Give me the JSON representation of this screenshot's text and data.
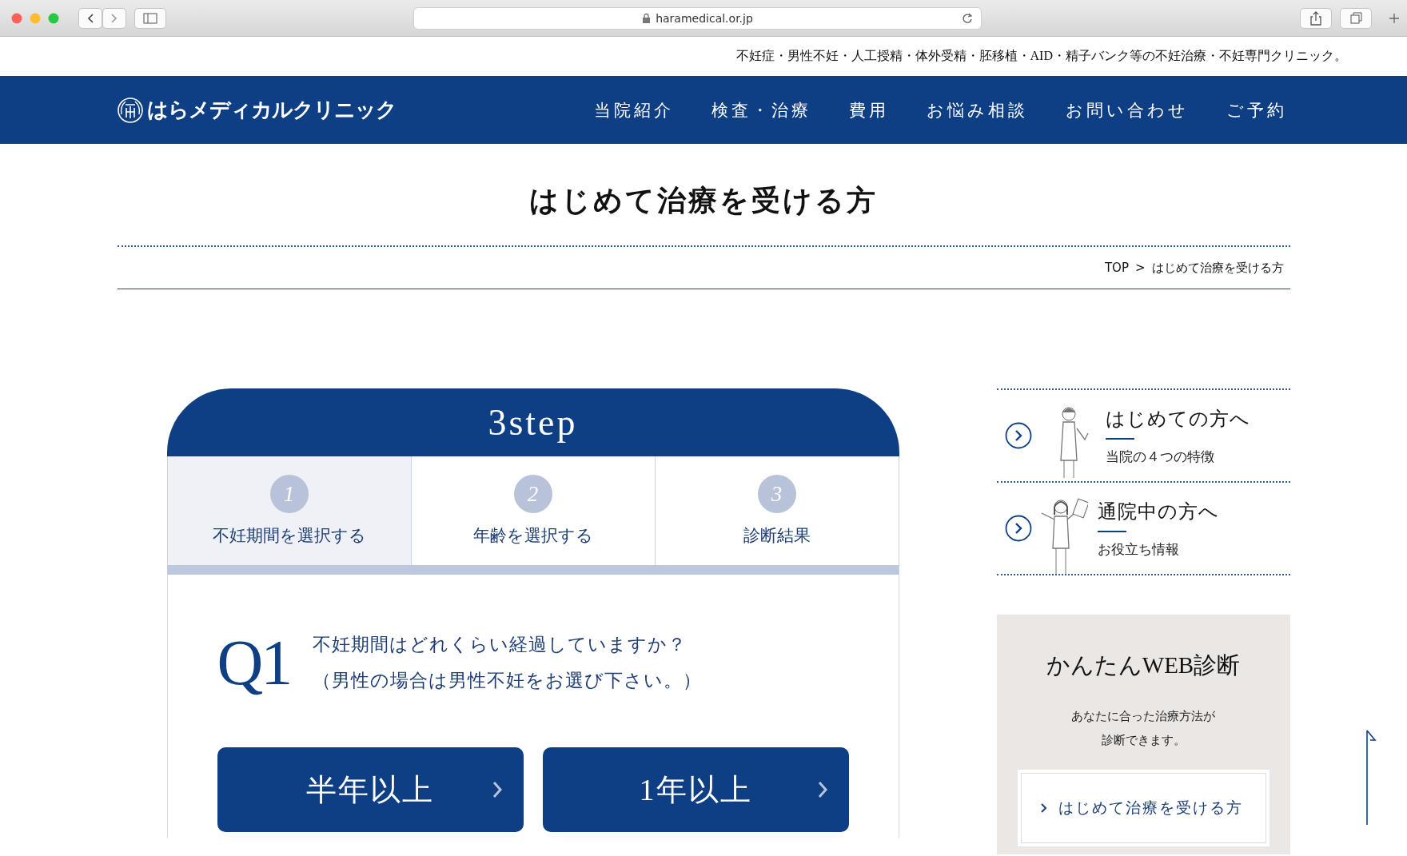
{
  "browser": {
    "url": "haramedical.or.jp"
  },
  "tagline": "不妊症・男性不妊・人工授精・体外受精・胚移植・AID・精子バンク等の不妊治療・不妊専門クリニック。",
  "header": {
    "logo": "はらメディカルクリニック",
    "nav": [
      {
        "label": "当院紹介"
      },
      {
        "label": "検査・治療"
      },
      {
        "label": "費用"
      },
      {
        "label": "お悩み相談"
      },
      {
        "label": "お問い合わせ"
      },
      {
        "label": "ご予約"
      }
    ]
  },
  "page_title": "はじめて治療を受ける方",
  "breadcrumb": {
    "items": [
      "TOP",
      "はじめて治療を受ける方"
    ],
    "separator": ">"
  },
  "diagnosis": {
    "title": "3step",
    "steps": [
      {
        "number": "1",
        "label": "不妊期間を選択する",
        "selected": true
      },
      {
        "number": "2",
        "label": "年齢を選択する",
        "selected": false
      },
      {
        "number": "3",
        "label": "診断結果",
        "selected": false
      }
    ],
    "question": {
      "label": "Q1",
      "lines": [
        "不妊期間はどれくらい経過していますか？",
        "（男性の場合は男性不妊をお選び下さい。）"
      ]
    },
    "answers": [
      {
        "label": "半年以上"
      },
      {
        "label": "1年以上"
      }
    ]
  },
  "sidebar": {
    "links": [
      {
        "title": "はじめての方へ",
        "subtitle": "当院の４つの特徴"
      },
      {
        "title": "通院中の方へ",
        "subtitle": "お役立ち情報"
      }
    ],
    "web_check": {
      "title": "かんたんWEB診断",
      "description": [
        "あなたに合った治療方法が",
        "診断できます。"
      ],
      "link": "はじめて治療を受ける方"
    }
  }
}
